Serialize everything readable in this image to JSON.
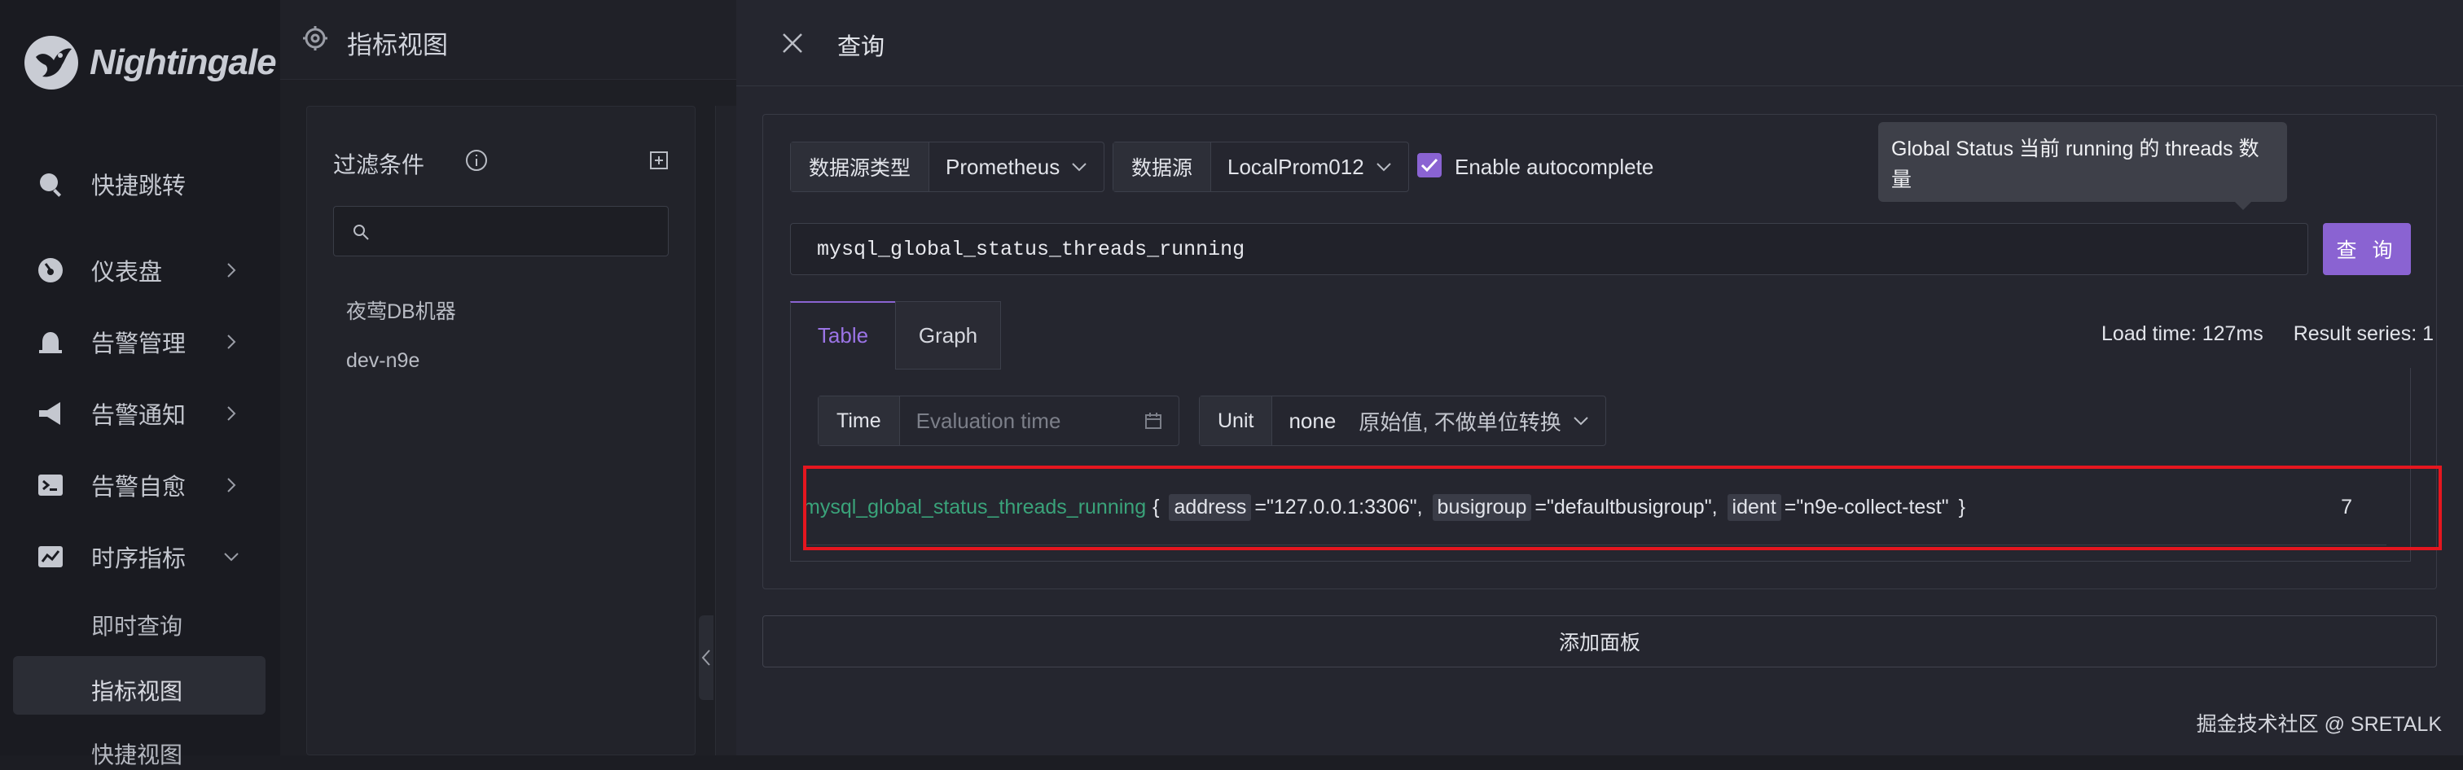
{
  "app": {
    "brand": "Nightingale"
  },
  "nav": {
    "items": [
      {
        "label": "快捷跳转",
        "icon": "search-icon"
      },
      {
        "label": "仪表盘",
        "icon": "dashboard-icon"
      },
      {
        "label": "告警管理",
        "icon": "alarm-icon"
      },
      {
        "label": "告警通知",
        "icon": "megaphone-icon"
      },
      {
        "label": "告警自愈",
        "icon": "terminal-icon"
      },
      {
        "label": "时序指标",
        "icon": "line-chart-icon"
      }
    ],
    "subitems": [
      "即时查询",
      "指标视图",
      "快捷视图"
    ],
    "active_sub": "指标视图"
  },
  "page": {
    "title": "指标视图"
  },
  "filter": {
    "title": "过滤条件",
    "search_placeholder": "",
    "items": [
      "夜莺DB机器",
      "dev-n9e"
    ]
  },
  "drawer": {
    "title": "查询",
    "datasource_type_label": "数据源类型",
    "datasource_type_value": "Prometheus",
    "datasource_label": "数据源",
    "datasource_value": "LocalProm012",
    "autocomplete_label": "Enable autocomplete",
    "autocomplete_checked": true,
    "tooltip": "Global Status 当前 running 的 threads 数量",
    "expression": "mysql_global_status_threads_running",
    "query_button": "查 询",
    "tabs": [
      "Table",
      "Graph"
    ],
    "active_tab": "Table",
    "load_time": "Load time: 127ms",
    "result_series": "Result series: 1",
    "time_label": "Time",
    "time_placeholder": "Evaluation time",
    "unit_label": "Unit",
    "unit_value": "none",
    "unit_desc": "原始值, 不做单位转换",
    "result": {
      "metric": "mysql_global_status_threads_running",
      "open_brace": "{",
      "labels": [
        {
          "key": "address",
          "value": "=\"127.0.0.1:3306\","
        },
        {
          "key": "busigroup",
          "value": "=\"defaultbusigroup\","
        },
        {
          "key": "ident",
          "value": "=\"n9e-collect-test\""
        }
      ],
      "close_brace": "}",
      "value": "7"
    },
    "add_panel_button": "添加面板"
  },
  "watermark": "掘金技术社区 @ SRETALK",
  "colors": {
    "accent": "#8a63d2",
    "metric_green": "#3aa37a",
    "highlight_red": "#e5161f"
  }
}
